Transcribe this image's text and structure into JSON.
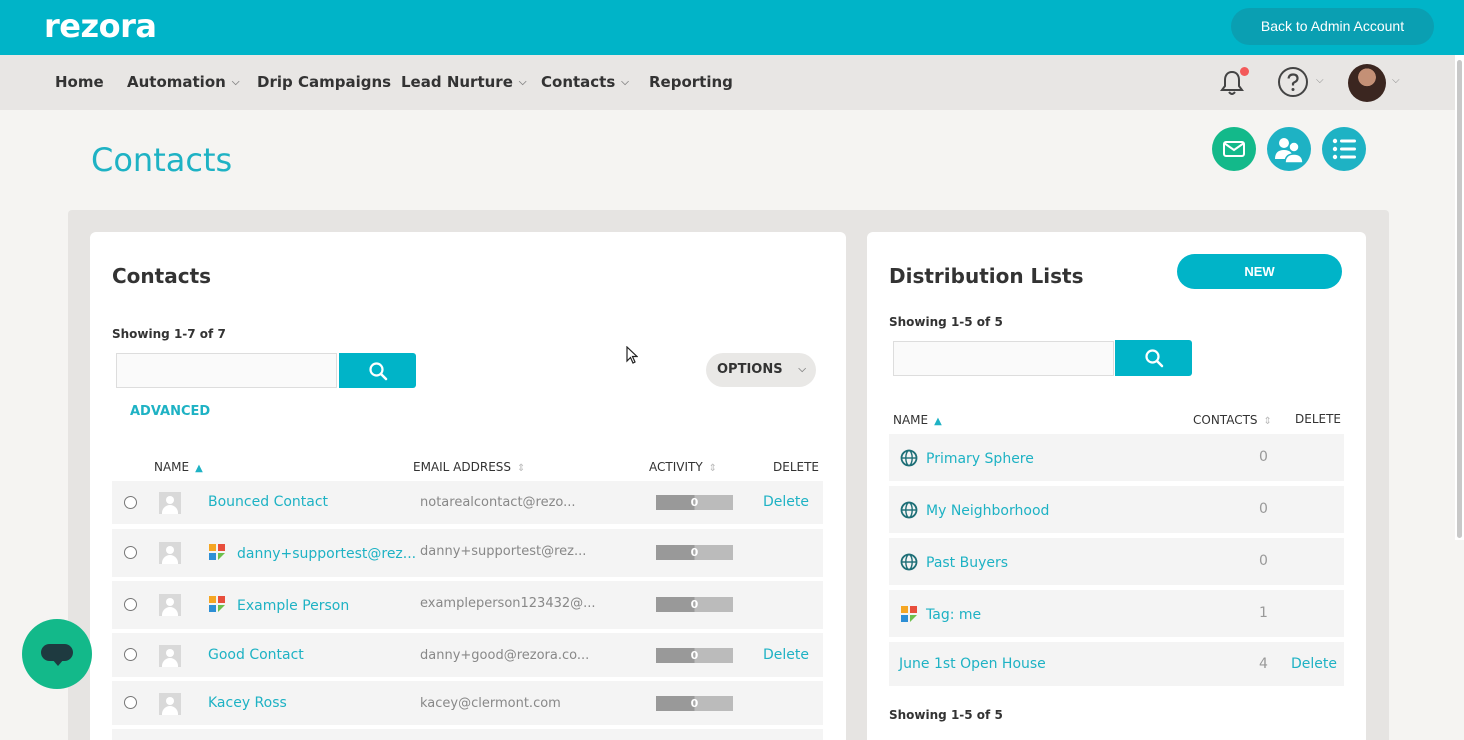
{
  "brand": {
    "logo": "rezora",
    "accent": "#00b4c8",
    "green": "#13b98a"
  },
  "header": {
    "back_button": "Back to Admin Account"
  },
  "nav": {
    "items": [
      {
        "label": "Home",
        "dropdown": false
      },
      {
        "label": "Automation",
        "dropdown": true
      },
      {
        "label": "Drip Campaigns",
        "dropdown": false
      },
      {
        "label": "Lead Nurture",
        "dropdown": true
      },
      {
        "label": "Contacts",
        "dropdown": true
      },
      {
        "label": "Reporting",
        "dropdown": false
      }
    ],
    "icons": [
      "bell-icon",
      "help-icon",
      "avatar"
    ]
  },
  "page": {
    "title": "Contacts",
    "action_icons": [
      "mail-icon",
      "people-icon",
      "list-icon"
    ]
  },
  "contacts": {
    "title": "Contacts",
    "showing": "Showing 1-7 of 7",
    "search_placeholder": "",
    "options_label": "OPTIONS",
    "advanced_label": "ADVANCED",
    "columns": {
      "name": "NAME",
      "email": "EMAIL ADDRESS",
      "activity": "ACTIVITY",
      "delete": "DELETE"
    },
    "rows": [
      {
        "name": "Bounced Contact",
        "email": "notarealcontact@rezo...",
        "activity": "0",
        "delete": "Delete",
        "tagged": false
      },
      {
        "name": "danny+supportest@rez...",
        "email": "danny+supportest@rez...",
        "activity": "0",
        "delete": "",
        "tagged": true
      },
      {
        "name": "Example Person",
        "email": "exampleperson123432@...",
        "activity": "0",
        "delete": "",
        "tagged": true
      },
      {
        "name": "Good Contact",
        "email": "danny+good@rezora.co...",
        "activity": "0",
        "delete": "Delete",
        "tagged": false
      },
      {
        "name": "Kacey Ross",
        "email": "kacey@clermont.com",
        "activity": "0",
        "delete": "",
        "tagged": false
      }
    ]
  },
  "lists": {
    "title": "Distribution Lists",
    "new_label": "NEW",
    "showing_top": "Showing 1-5 of 5",
    "showing_bottom": "Showing 1-5 of 5",
    "search_placeholder": "",
    "columns": {
      "name": "NAME",
      "contacts": "CONTACTS",
      "delete": "DELETE"
    },
    "rows": [
      {
        "name": "Primary Sphere",
        "count": "0",
        "delete": "",
        "icon": "globe-icon"
      },
      {
        "name": "My Neighborhood",
        "count": "0",
        "delete": "",
        "icon": "globe-icon"
      },
      {
        "name": "Past Buyers",
        "count": "0",
        "delete": "",
        "icon": "globe-icon"
      },
      {
        "name": "Tag: me",
        "count": "1",
        "delete": "",
        "icon": "tag-icon"
      },
      {
        "name": "June 1st Open House",
        "count": "4",
        "delete": "Delete",
        "icon": ""
      }
    ]
  }
}
